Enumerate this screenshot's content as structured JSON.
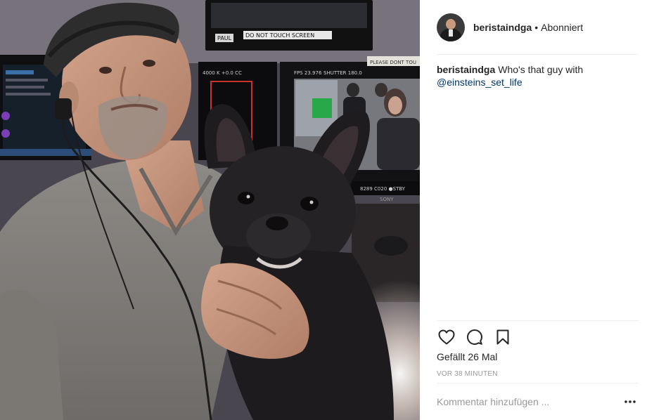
{
  "photo": {
    "monitor_labels": {
      "top_a": "PAUL",
      "top_b": "DO NOT TOUCH SCREEN",
      "right_top": "PLEASE DONT TOU",
      "left_stats": "4000 K  +0.0 CC",
      "right_stats_a": "FPS 23.976",
      "right_stats_b": "SHUTTER 180.0",
      "lower_stats": "8289  C020  ●STBY",
      "lower_brand": "SONY"
    }
  },
  "header": {
    "username": "beristaindga",
    "separator": "•",
    "follow_label": "Abonniert"
  },
  "caption": {
    "username": "beristaindga",
    "text": "Who's that guy with",
    "mention": "@einsteins_set_life"
  },
  "actions": {
    "like_icon": "heart-icon",
    "comment_icon": "comment-icon",
    "save_icon": "bookmark-icon"
  },
  "likes": {
    "label": "Gefällt 26 Mal"
  },
  "timestamp": "VOR 38 MINUTEN",
  "comment": {
    "placeholder": "Kommentar hinzufügen ...",
    "more_icon": "more-options-icon"
  }
}
